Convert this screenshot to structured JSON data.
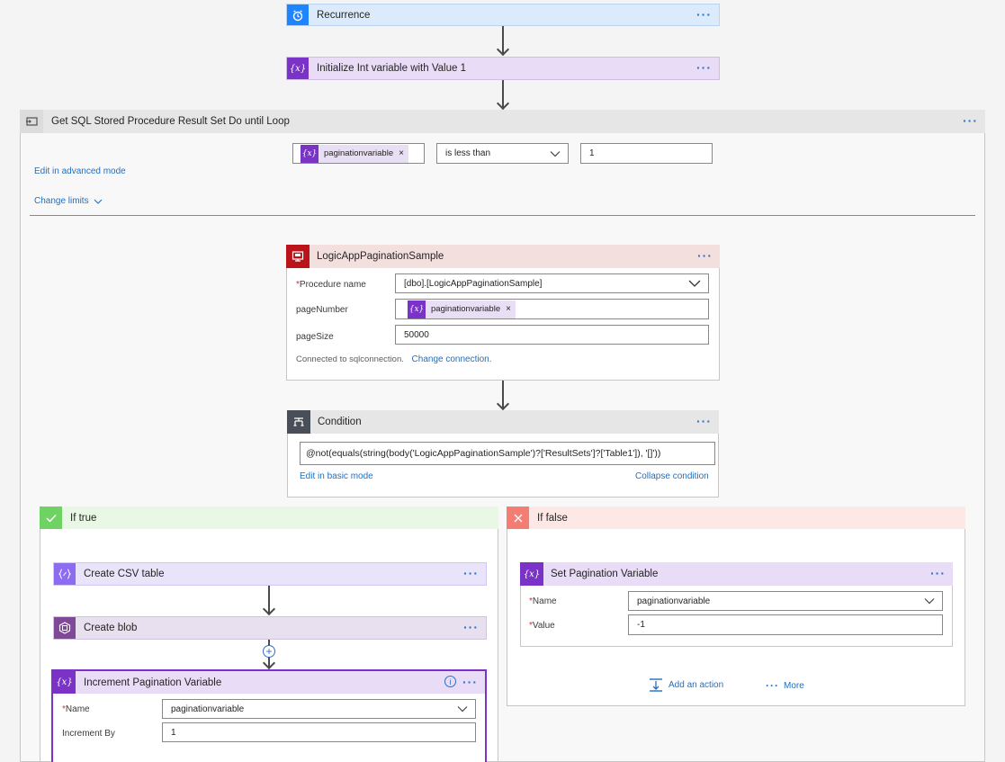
{
  "recurrence": {
    "title": "Recurrence",
    "more": "···"
  },
  "init_var": {
    "title": "Initialize Int variable with Value 1",
    "more": "···",
    "icon": "{x}"
  },
  "loop": {
    "title": "Get SQL Stored Procedure Result Set Do until Loop",
    "more": "···",
    "condition_token": "paginationvariable",
    "token_icon": "{x}",
    "token_remove": "×",
    "operator": "is less than",
    "value": "1",
    "edit_link": "Edit in advanced mode",
    "limits_link": "Change limits"
  },
  "sql": {
    "title": "LogicAppPaginationSample",
    "more": "···",
    "procedure_label": "Procedure name",
    "procedure_value": "[dbo].[LogicAppPaginationSample]",
    "page_number_label": "pageNumber",
    "page_number_token": "paginationvariable",
    "page_size_label": "pageSize",
    "page_size_value": "50000",
    "connected_text": "Connected to sqlconnection.",
    "change_connection": "Change connection."
  },
  "condition": {
    "title": "Condition",
    "more": "···",
    "expression": "@not(equals(string(body('LogicAppPaginationSample')?['ResultSets']?['Table1']), '[]'))",
    "edit_link": "Edit in basic mode",
    "collapse_link": "Collapse condition"
  },
  "if_true": {
    "title": "If true",
    "csv": {
      "title": "Create CSV table",
      "more": "···"
    },
    "blob": {
      "title": "Create blob",
      "more": "···"
    },
    "increment": {
      "title": "Increment Pagination Variable",
      "more": "···",
      "info": "i",
      "name_label": "Name",
      "name_value": "paginationvariable",
      "by_label": "Increment By",
      "by_value": "1"
    }
  },
  "if_false": {
    "title": "If false",
    "set_var": {
      "title": "Set Pagination Variable",
      "more": "···",
      "name_label": "Name",
      "name_value": "paginationvariable",
      "value_label": "Value",
      "value_value": "-1"
    },
    "add_action": "Add an action",
    "more_dots": "···",
    "more_label": "More"
  },
  "colors": {
    "recurrence_bg": "#dcebfb",
    "recurrence_icon": "#1f85ff",
    "variable_bg": "#e9dcf7",
    "variable_icon": "#7a33c6",
    "sql_bg": "#f4dfdf",
    "sql_icon": "#ba141a",
    "condition_bg": "#e6e6e6",
    "condition_icon": "#484f58",
    "true_bg": "#e9f7e5",
    "true_icon": "#6fd364",
    "false_bg": "#fde8e5",
    "false_icon": "#f47d73"
  },
  "icons": [
    "alarm-clock-icon",
    "variable-icon",
    "loop-icon",
    "sql-icon",
    "condition-icon",
    "check-icon",
    "cross-icon",
    "csv-icon",
    "blob-icon",
    "info-icon",
    "add-action-icon",
    "plus-circle-icon",
    "chevron-down-icon"
  ]
}
